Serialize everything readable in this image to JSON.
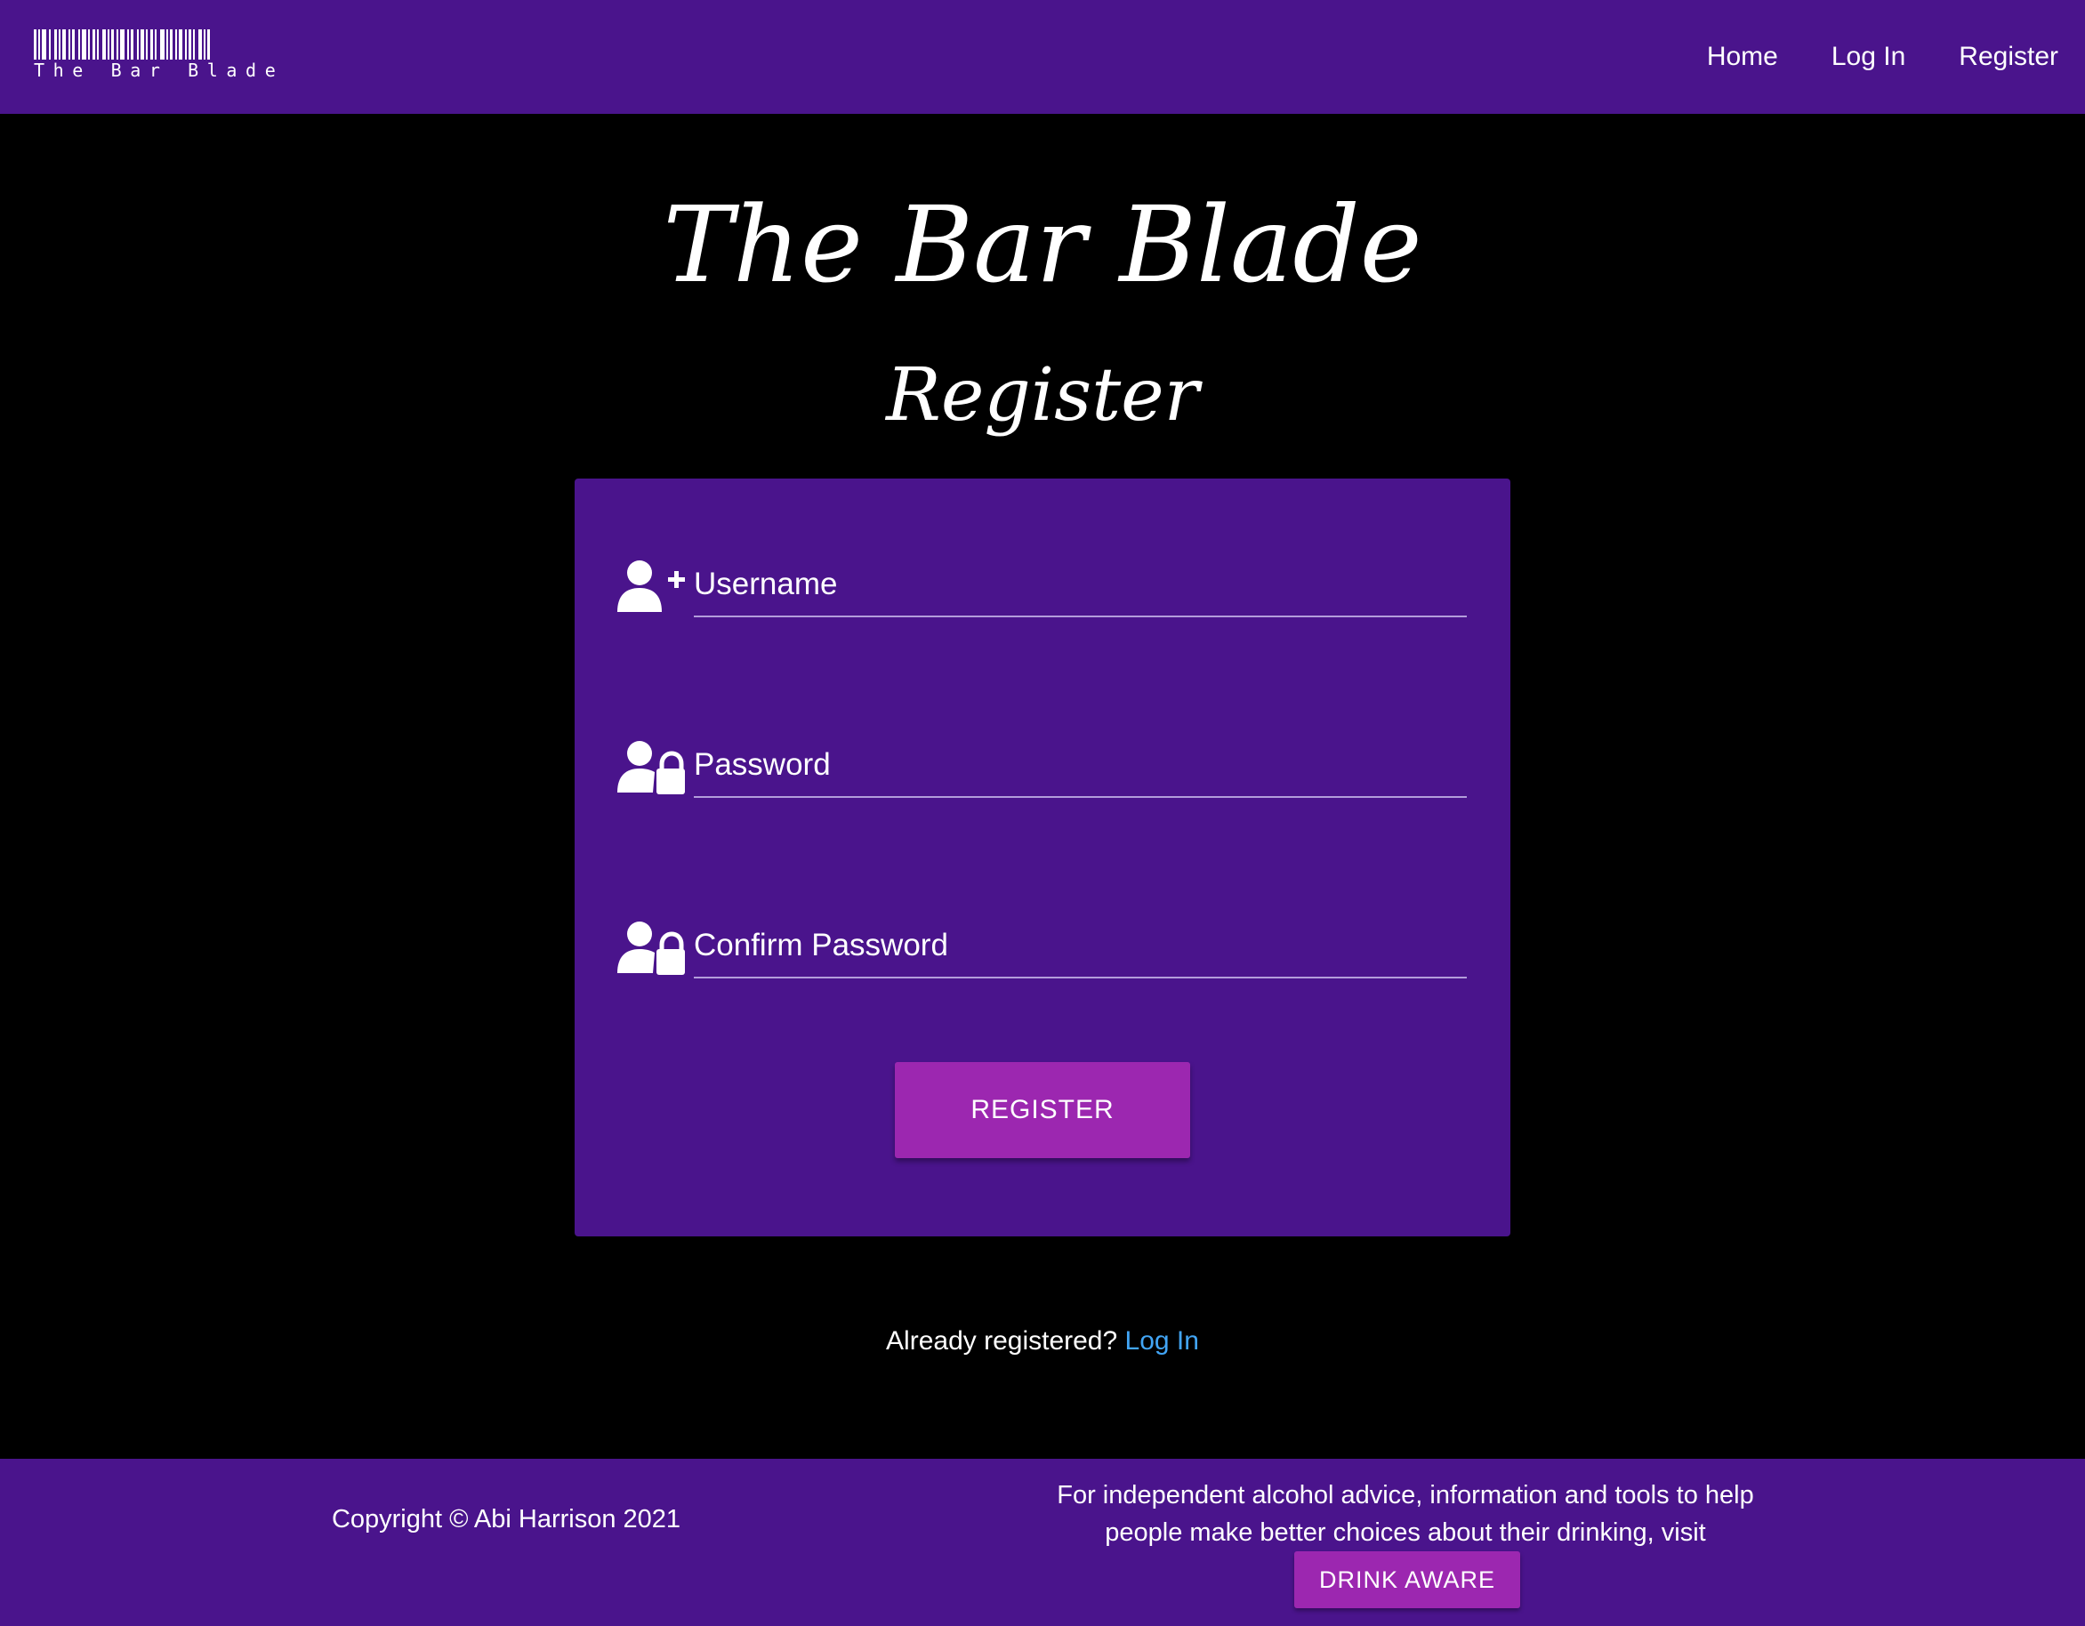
{
  "navbar": {
    "brand_text": "The Bar Blade",
    "links": [
      {
        "label": "Home"
      },
      {
        "label": "Log In"
      },
      {
        "label": "Register"
      }
    ]
  },
  "main": {
    "site_title": "The Bar Blade",
    "page_title": "Register"
  },
  "form": {
    "fields": [
      {
        "label": "Username",
        "icon": "user-plus-icon",
        "value": ""
      },
      {
        "label": "Password",
        "icon": "user-lock-icon",
        "value": ""
      },
      {
        "label": "Confirm Password",
        "icon": "user-lock-icon",
        "value": ""
      }
    ],
    "submit_label": "REGISTER"
  },
  "login_prompt": {
    "text": "Already registered?",
    "link_label": "Log In"
  },
  "footer": {
    "copyright": "Copyright © Abi Harrison 2021",
    "advice": "For independent alcohol advice, information and tools to help people make better choices about their drinking, visit",
    "drink_aware_label": "DRINK AWARE"
  },
  "colors": {
    "primary_purple": "#4a148c",
    "button_purple": "#9c27b0",
    "link_blue": "#42a5f5",
    "background": "#000000"
  }
}
